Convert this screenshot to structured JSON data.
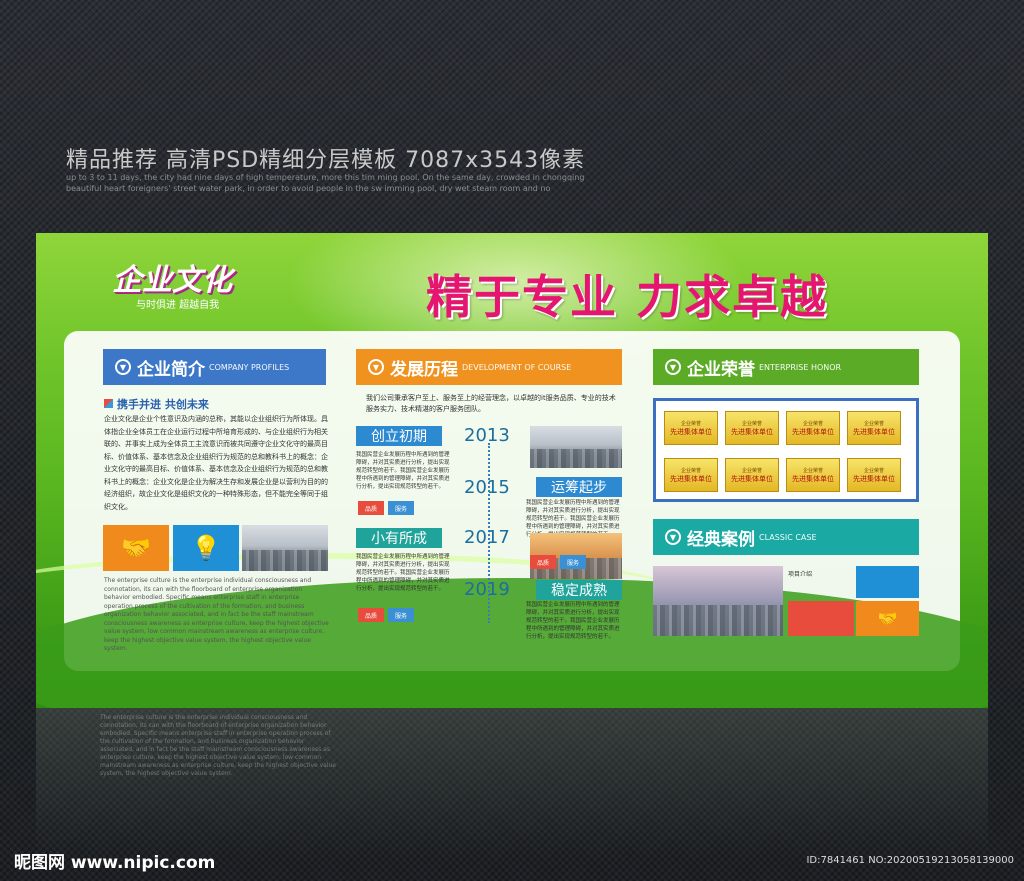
{
  "header": {
    "title": "精品推荐 高清PSD精细分层模板 7087x3543像素",
    "subtitle": "up to 3 to 11 days, the city had nine days of high temperature, more this tim ming pool. On the same day, crowded in chongqing beautiful heart foreigners' street water park, in order to avoid people in the sw imming pool, dry wet steam room and no"
  },
  "board": {
    "logo": "企业文化",
    "logo_sub": "与时俱进 超越自我",
    "slogan": "精于专业 力求卓越",
    "s1": {
      "title": "企业简介",
      "en": "COMPANY PROFILES",
      "subhead": "携手并进 共创未来",
      "body": "企业文化是企业个性意识及内涵的总称，其能以企业组织行为所体现。具体指企业全体员工在企业运行过程中所培育形成的、与企业组织行为相关联的、并事实上成为全体员工主流意识而被共同遵守企业文化守的最高目标、价值体系、基本信念及企业组织行为规范的总和教科书上的概念：企业文化守的最高目标、价值体系、基本信念及企业组织行为规范的总和教科书上的概念：企业文化是企业为解决生存和发展企业是以营利为目的的经济组织，故企业文化是组织文化的一种特殊形态，但不能完全等同于组织文化。",
      "en_body": "The enterprise culture is the enterprise individual consciousness and connotation, its can with the floorboard of enterprise organization behavior embodied. Specific means enterprise staff in enterprise operation process of the cultivation of the formation, and business organization behavior associated, and in fact be the staff mainstream consciousness awareness as enterprise culture, keep the highest objective value system, low common mainstream awareness as enterprise culture, keep the highest objective value system, the highest objective value system."
    },
    "s2": {
      "title": "发展历程",
      "en": "DEVELOPMENT OF COURSE",
      "intro": "我们公司秉承客户至上、服务至上的经营理念，以卓越的it服务品质、专业的技术服务实力、技术精湛的客户服务团队。",
      "tags": [
        "创立初期",
        "运筹起步",
        "小有所成",
        "稳定成熟"
      ],
      "years": [
        "2013",
        "2015",
        "2017",
        "2019"
      ],
      "item_text": "我国民营企业发展历程中所遇到的管理障碍，并对其实质进行分析，提出实现规范转型的若干。我国民营企业发展历程中所遇到的管理障碍，并对其实质进行分析，提出实现规范转型的若干。",
      "mini1": "品质",
      "mini2": "服务"
    },
    "s3": {
      "title": "企业荣誉",
      "en": "ENTERPRISE HONOR",
      "cert_top": "企业荣誉",
      "cert_main": "先进集体单位"
    },
    "s4": {
      "title": "经典案例",
      "en": "CLASSIC CASE",
      "label": "项目介绍"
    }
  },
  "footer": {
    "site": "昵图网 www.nipic.com",
    "id": "ID:7841461 NO:20200519213058139000"
  }
}
